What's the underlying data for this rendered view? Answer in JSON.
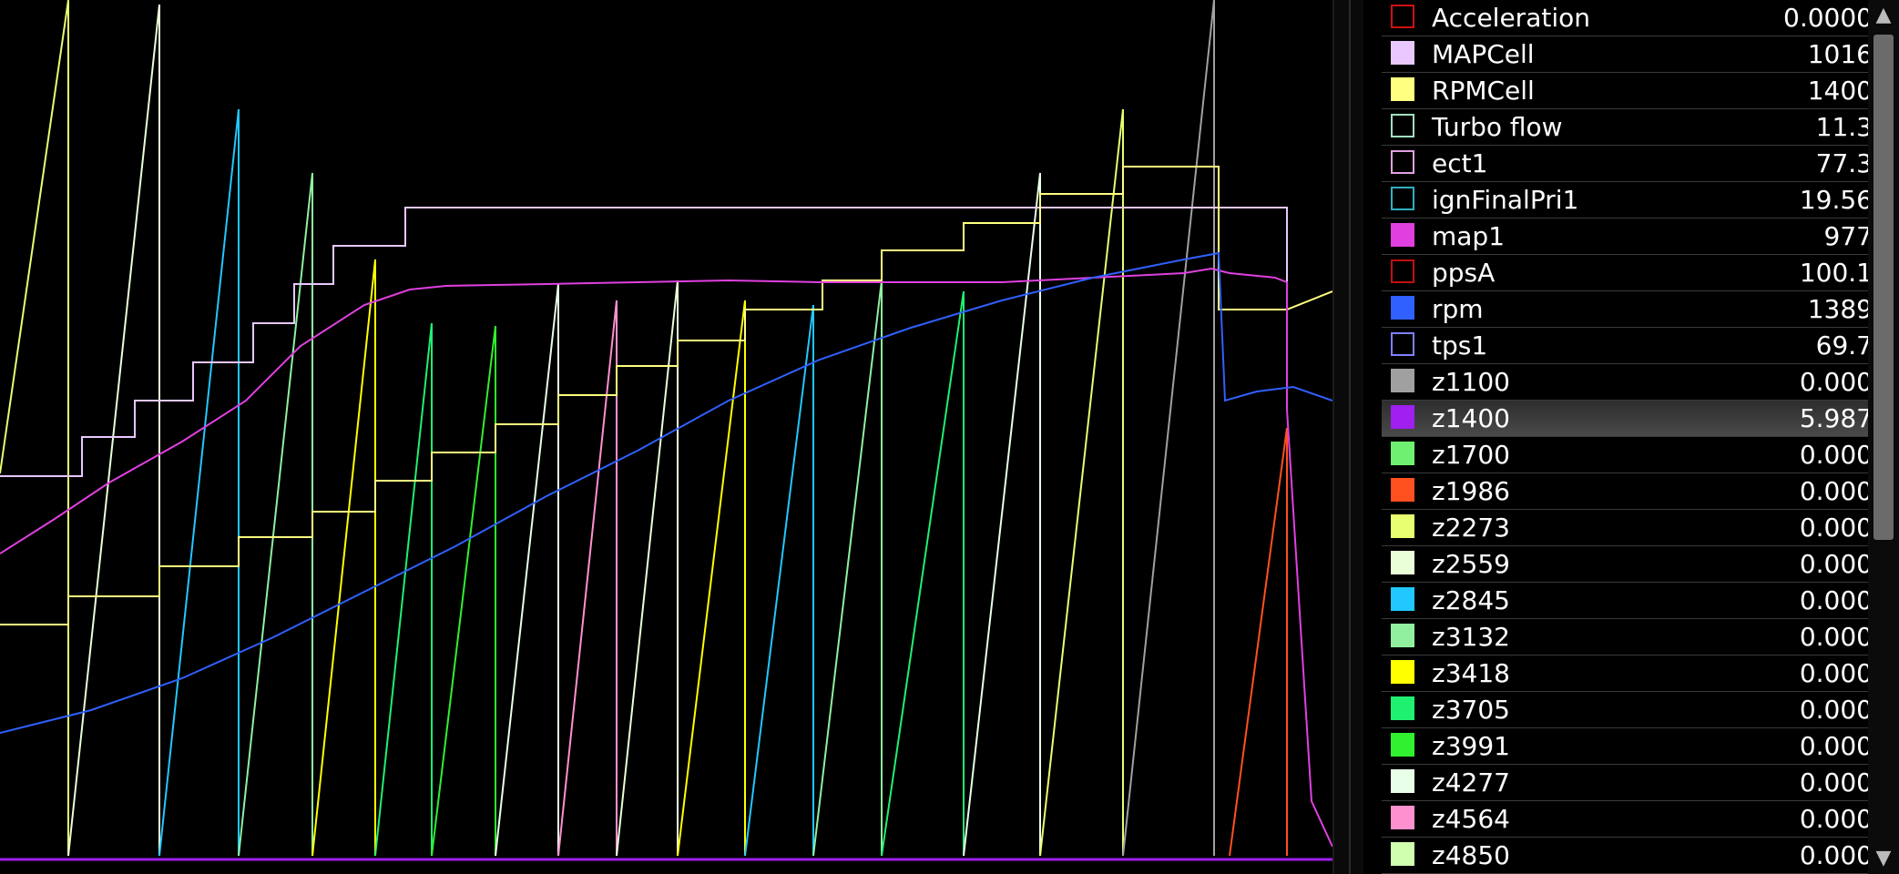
{
  "plot": {
    "baseline_color": "#a020f0"
  },
  "legend": {
    "selected_index": 11,
    "channels": [
      {
        "name": "Acceleration",
        "value": "0.0000",
        "color": "#000000",
        "border": "#d01010"
      },
      {
        "name": "MAPCell",
        "value": "1016",
        "color": "#e8c8ff",
        "border": "#e8c8ff"
      },
      {
        "name": "RPMCell",
        "value": "1400",
        "color": "#ffff80",
        "border": "#ffff80"
      },
      {
        "name": "Turbo flow",
        "value": "11.3",
        "color": "#000000",
        "border": "#a0e0c0"
      },
      {
        "name": "ect1",
        "value": "77.3",
        "color": "#000000",
        "border": "#e0a0e0"
      },
      {
        "name": "ignFinalPri1",
        "value": "19.56",
        "color": "#000000",
        "border": "#30b0c0"
      },
      {
        "name": "map1",
        "value": "977",
        "color": "#e040e0",
        "border": "#e040e0"
      },
      {
        "name": "ppsA",
        "value": "100.1",
        "color": "#000000",
        "border": "#c01010"
      },
      {
        "name": "rpm",
        "value": "1389",
        "color": "#3060ff",
        "border": "#3060ff"
      },
      {
        "name": "tps1",
        "value": "69.7",
        "color": "#000000",
        "border": "#8080ff"
      },
      {
        "name": "z1100",
        "value": "0.000",
        "color": "#a0a0a0",
        "border": "#a0a0a0"
      },
      {
        "name": "z1400",
        "value": "5.987",
        "color": "#a020f0",
        "border": "#a020f0"
      },
      {
        "name": "z1700",
        "value": "0.000",
        "color": "#70f070",
        "border": "#70f070"
      },
      {
        "name": "z1986",
        "value": "0.000",
        "color": "#ff5020",
        "border": "#ff5020"
      },
      {
        "name": "z2273",
        "value": "0.000",
        "color": "#e8ff70",
        "border": "#e8ff70"
      },
      {
        "name": "z2559",
        "value": "0.000",
        "color": "#eaffd8",
        "border": "#eaffd8"
      },
      {
        "name": "z2845",
        "value": "0.000",
        "color": "#20c8ff",
        "border": "#20c8ff"
      },
      {
        "name": "z3132",
        "value": "0.000",
        "color": "#90f0a0",
        "border": "#90f0a0"
      },
      {
        "name": "z3418",
        "value": "0.000",
        "color": "#ffff00",
        "border": "#ffff00"
      },
      {
        "name": "z3705",
        "value": "0.000",
        "color": "#20f070",
        "border": "#20f070"
      },
      {
        "name": "z3991",
        "value": "0.000",
        "color": "#30f030",
        "border": "#30f030"
      },
      {
        "name": "z4277",
        "value": "0.000",
        "color": "#e8ffe8",
        "border": "#e8ffe8"
      },
      {
        "name": "z4564",
        "value": "0.000",
        "color": "#ff90d0",
        "border": "#ff90d0"
      },
      {
        "name": "z4850",
        "value": "0.000",
        "color": "#d0ffb0",
        "border": "#d0ffb0"
      }
    ]
  }
}
